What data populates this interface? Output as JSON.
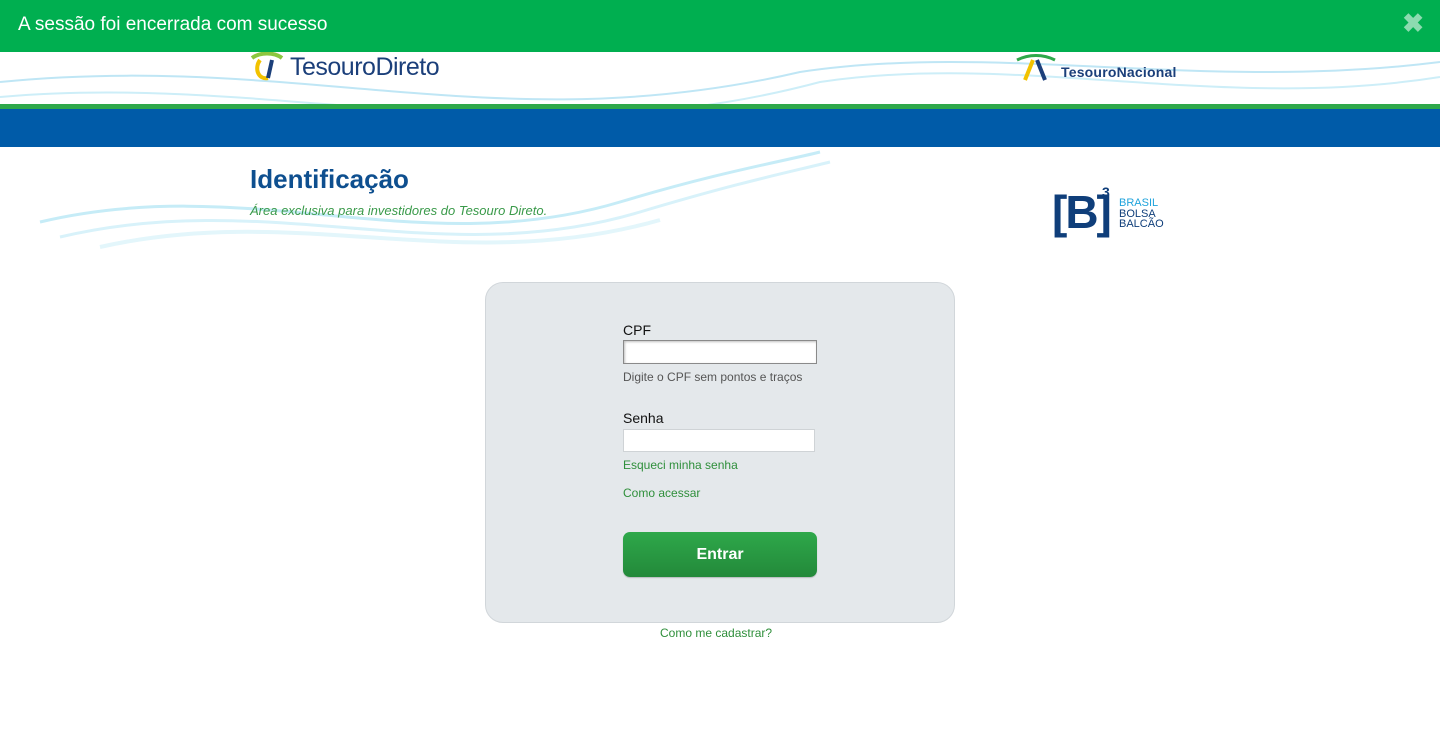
{
  "toast": {
    "message": "A sessão foi encerrada com sucesso",
    "close_symbol": "✖"
  },
  "header": {
    "logo_left": {
      "text": "TesouroDireto",
      "icon": "tesouro-direto-logo-icon"
    },
    "logo_right": {
      "text": "TesouroNacional",
      "icon": "tesouro-nacional-logo-icon"
    }
  },
  "page": {
    "title": "Identificação",
    "subtitle": "Área exclusiva para investidores do Tesouro Direto."
  },
  "b3_logo": {
    "mark": "[B]",
    "sup": "3",
    "line1": "BRASIL",
    "line2": "BOLSA",
    "line3": "BALCÃO"
  },
  "login": {
    "cpf_label": "CPF",
    "cpf_value": "",
    "cpf_hint": "Digite o CPF sem pontos e traços",
    "password_label": "Senha",
    "password_value": "",
    "forgot_link": "Esqueci minha senha",
    "howto_link": "Como acessar",
    "submit_label": "Entrar",
    "register_link": "Como me cadastrar?"
  },
  "colors": {
    "toast_bg": "#00af50",
    "brand_blue": "#005ba8",
    "brand_green": "#2ea84a",
    "title_blue": "#0e4f8f"
  }
}
